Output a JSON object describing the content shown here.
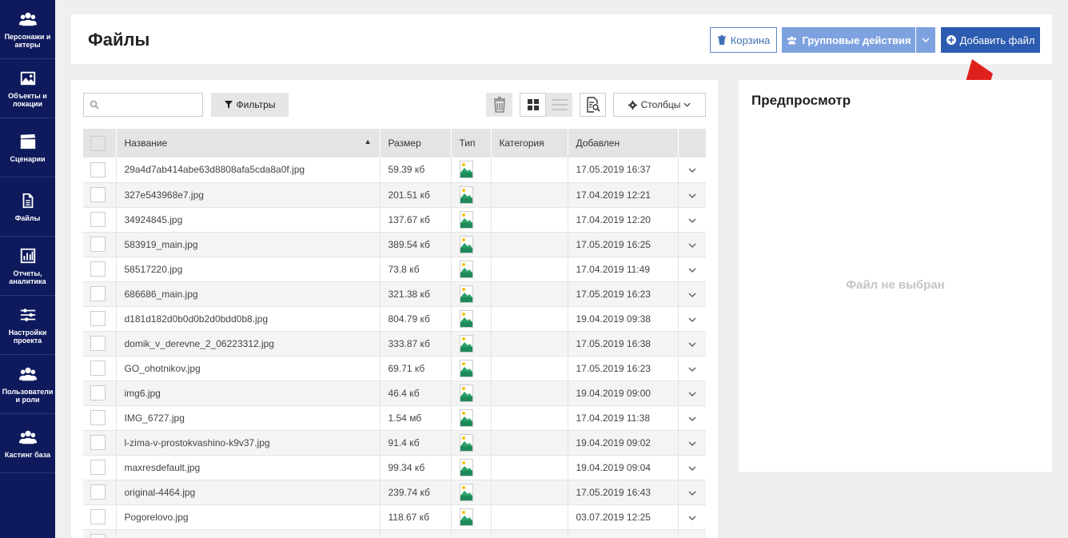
{
  "sidebar": {
    "items": [
      {
        "label": "Персонажи и актеры",
        "icon": "users-icon"
      },
      {
        "label": "Объекты и локации",
        "icon": "image-icon"
      },
      {
        "label": "Сценарии",
        "icon": "clapperboard-icon"
      },
      {
        "label": "Файлы",
        "icon": "file-icon"
      },
      {
        "label": "Отчеты, аналитика",
        "icon": "chart-icon"
      },
      {
        "label": "Настройки проекта",
        "icon": "sliders-icon"
      },
      {
        "label": "Пользователи и роли",
        "icon": "users-icon"
      },
      {
        "label": "Кастинг база",
        "icon": "users-icon"
      }
    ]
  },
  "header": {
    "title": "Файлы",
    "trash_label": "Корзина",
    "group_label": "Групповые действия",
    "add_label": "Добавить файл"
  },
  "toolbar": {
    "search_placeholder": "",
    "filters_label": "Фильтры",
    "columns_label": "Столбцы"
  },
  "table": {
    "headers": {
      "name": "Название",
      "size": "Размер",
      "type": "Тип",
      "category": "Категория",
      "added": "Добавлен"
    },
    "rows": [
      {
        "name": "29a4d7ab414abe63d8808afa5cda8a0f.jpg",
        "size": "59.39 кб",
        "category": "",
        "added": "17.05.2019 16:37"
      },
      {
        "name": "327e543968e7.jpg",
        "size": "201.51 кб",
        "category": "",
        "added": "17.04.2019 12:21"
      },
      {
        "name": "34924845.jpg",
        "size": "137.67 кб",
        "category": "",
        "added": "17.04.2019 12:20"
      },
      {
        "name": "583919_main.jpg",
        "size": "389.54 кб",
        "category": "",
        "added": "17.05.2019 16:25"
      },
      {
        "name": "58517220.jpg",
        "size": "73.8 кб",
        "category": "",
        "added": "17.04.2019 11:49"
      },
      {
        "name": "686686_main.jpg",
        "size": "321.38 кб",
        "category": "",
        "added": "17.05.2019 16:23"
      },
      {
        "name": "d181d182d0b0d0b2d0bdd0b8.jpg",
        "size": "804.79 кб",
        "category": "",
        "added": "19.04.2019 09:38"
      },
      {
        "name": "domik_v_derevne_2_06223312.jpg",
        "size": "333.87 кб",
        "category": "",
        "added": "17.05.2019 16:38"
      },
      {
        "name": "GO_ohotnikov.jpg",
        "size": "69.71 кб",
        "category": "",
        "added": "17.05.2019 16:23"
      },
      {
        "name": "img6.jpg",
        "size": "46.4 кб",
        "category": "",
        "added": "19.04.2019 09:00"
      },
      {
        "name": "IMG_6727.jpg",
        "size": "1.54 мб",
        "category": "",
        "added": "17.04.2019 11:38"
      },
      {
        "name": "l-zima-v-prostokvashino-k9v37.jpg",
        "size": "91.4 кб",
        "category": "",
        "added": "19.04.2019 09:02"
      },
      {
        "name": "maxresdefault.jpg",
        "size": "99.34 кб",
        "category": "",
        "added": "19.04.2019 09:04"
      },
      {
        "name": "original-4464.jpg",
        "size": "239.74 кб",
        "category": "",
        "added": "17.05.2019 16:43"
      },
      {
        "name": "Pogorelovo.jpg",
        "size": "118.67 кб",
        "category": "",
        "added": "03.07.2019 12:25"
      },
      {
        "name": "",
        "size": "",
        "category": "",
        "added": ""
      }
    ]
  },
  "preview": {
    "title": "Предпросмотр",
    "empty_text": "Файл не выбран"
  },
  "colors": {
    "sidebar_bg": "#0e1a5c",
    "primary": "#2c5cb0",
    "group_btn": "#7ea2e0",
    "annotation_arrow": "#e0201c"
  }
}
